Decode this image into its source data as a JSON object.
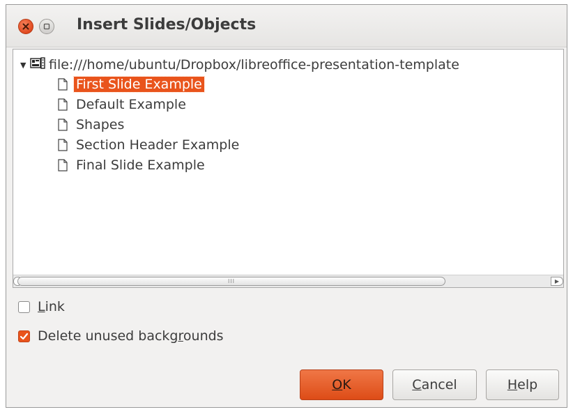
{
  "window": {
    "title": "Insert Slides/Objects"
  },
  "tree": {
    "root": {
      "label": "file:///home/ubuntu/Dropbox/libreoffice-presentation-template",
      "expanded": true,
      "icon": "presentation-document-icon"
    },
    "items": [
      {
        "label": "First Slide Example",
        "selected": true
      },
      {
        "label": "Default Example",
        "selected": false
      },
      {
        "label": "Shapes",
        "selected": false
      },
      {
        "label": "Section Header Example",
        "selected": false
      },
      {
        "label": "Final Slide Example",
        "selected": false
      }
    ],
    "item_icon": "page-icon",
    "hscroll_grip": "III"
  },
  "options": {
    "link": {
      "mnemonic": "L",
      "rest": "ink",
      "checked": false
    },
    "delete_unused": {
      "before": "Delete unused backg",
      "mnemonic": "r",
      "after": "ounds",
      "checked": true
    }
  },
  "buttons": {
    "ok": {
      "mnemonic": "O",
      "rest": "K"
    },
    "cancel": {
      "mnemonic": "C",
      "rest": "ancel"
    },
    "help": {
      "mnemonic": "H",
      "rest": "elp"
    }
  },
  "colors": {
    "accent": "#e9541c",
    "dialog_bg": "#f2f1f0",
    "text": "#3c3c3c"
  }
}
